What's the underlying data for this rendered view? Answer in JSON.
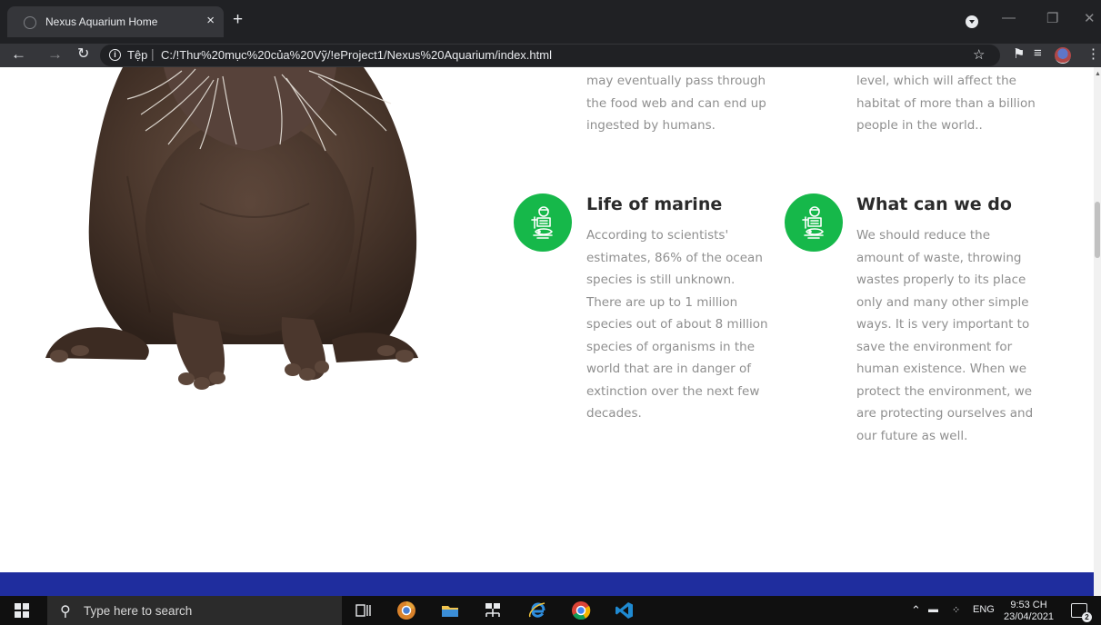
{
  "browser": {
    "tab_title": "Nexus Aquarium Home",
    "tab_close": "×",
    "new_tab": "+",
    "url_label": "Tệp",
    "url_separator": "|",
    "url": "C:/!Thư%20mục%20của%20Vỹ/!eProject1/Nexus%20Aquarium/index.html",
    "icons": [
      "back-icon",
      "forward-icon",
      "reload-icon",
      "info-icon",
      "star-icon",
      "puzzle-icon",
      "reading-list-icon",
      "profile-avatar",
      "menu-icon"
    ]
  },
  "features": {
    "top_left_text": "may eventually pass through the food web and can end up ingested by humans.",
    "top_right_text": "level, which will affect the habitat of more than a billion people in the world..",
    "marine": {
      "title": "Life of marine",
      "text": "According to scientists' estimates, 86% of the ocean species is still unknown.\nThere are up to 1 million species out of about 8 million species of organisms in the world that are in danger of extinction over the next few decades."
    },
    "action": {
      "title": "What can we do",
      "text": "We should reduce the amount of waste, throwing wastes properly to its place only and many other simple ways. It is very important to save the environment for human existence. When we protect the environment, we are protecting ourselves and our future as well."
    },
    "accent_color": "#16b84a"
  },
  "footer_color": "#1f2d9e",
  "taskbar": {
    "search_placeholder": "Type here to search",
    "language": "ENG",
    "time": "9:53 CH",
    "date": "23/04/2021",
    "notification_count": "2"
  }
}
